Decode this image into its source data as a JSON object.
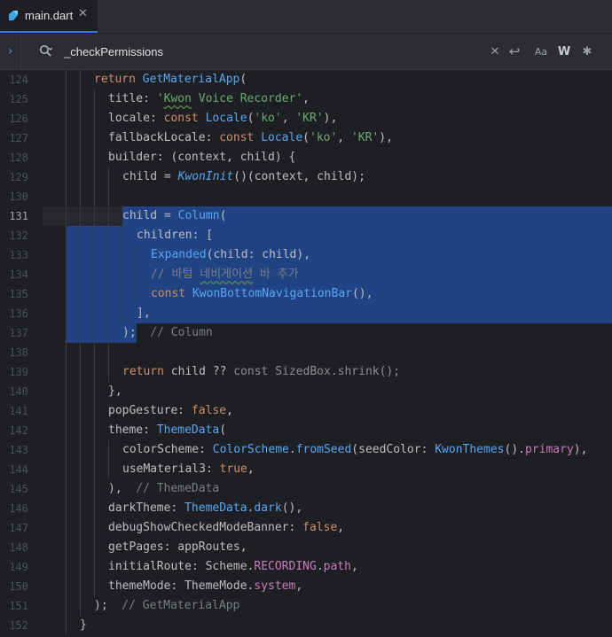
{
  "tab": {
    "label": "main.dart",
    "close_glyph": "✕",
    "icon": "dart-file-icon"
  },
  "search": {
    "query": "_checkPermissions",
    "clear_glyph": "✕",
    "newline_glyph": "↩",
    "match_case_label": "Aa",
    "whole_words_label": "W",
    "regex_glyph": "✱",
    "expand_glyph": "›"
  },
  "editor": {
    "current_line": 131,
    "line_numbers": [
      "124",
      "125",
      "126",
      "127",
      "128",
      "129",
      "130",
      "131",
      "132",
      "133",
      "134",
      "135",
      "136",
      "137",
      "138",
      "139",
      "140",
      "141",
      "142",
      "143",
      "144",
      "145",
      "146",
      "147",
      "148",
      "149",
      "150",
      "151",
      "152"
    ],
    "lines": [
      [
        [
          "kw",
          "return "
        ],
        [
          "fn",
          "GetMaterialApp"
        ],
        [
          "",
          "("
        ]
      ],
      [
        [
          "",
          "title: "
        ],
        [
          "str",
          "'"
        ],
        [
          "str typo",
          "Kwon"
        ],
        [
          "str",
          " Voice Recorder'"
        ],
        [
          "",
          ","
        ]
      ],
      [
        [
          "",
          "locale: "
        ],
        [
          "kw",
          "const "
        ],
        [
          "fn",
          "Locale"
        ],
        [
          "",
          "("
        ],
        [
          "str",
          "'ko'"
        ],
        [
          "",
          ", "
        ],
        [
          "str",
          "'KR'"
        ],
        [
          "",
          "),"
        ]
      ],
      [
        [
          "",
          "fallbackLocale: "
        ],
        [
          "kw",
          "const "
        ],
        [
          "fn",
          "Locale"
        ],
        [
          "",
          "("
        ],
        [
          "str",
          "'ko'"
        ],
        [
          "",
          ", "
        ],
        [
          "str",
          "'KR'"
        ],
        [
          "",
          "),"
        ]
      ],
      [
        [
          "",
          "builder: (context, child) {"
        ]
      ],
      [
        [
          "",
          "child = "
        ],
        [
          "fn ital",
          "KwonInit"
        ],
        [
          "",
          "()(context, child);"
        ]
      ],
      [],
      [
        [
          "",
          "child = "
        ],
        [
          "fn",
          "Column"
        ],
        [
          "",
          "("
        ]
      ],
      [
        [
          "",
          "children: ["
        ]
      ],
      [
        [
          "fn",
          "Expanded"
        ],
        [
          "",
          "(child: child),"
        ]
      ],
      [
        [
          "cm",
          "// 바텀 "
        ],
        [
          "cm typo",
          "네비게이션"
        ],
        [
          "cm",
          " 바 추가"
        ]
      ],
      [
        [
          "kw",
          "const "
        ],
        [
          "fn",
          "KwonBottomNavigationBar"
        ],
        [
          "",
          "(),"
        ]
      ],
      [
        [
          "",
          "],"
        ]
      ],
      [
        [
          "",
          "); "
        ],
        [
          "cm",
          " // Column"
        ]
      ],
      [],
      [
        [
          "kw",
          "return "
        ],
        [
          "",
          "child ?? "
        ],
        [
          "dim",
          "const SizedBox.shrink();"
        ]
      ],
      [
        [
          "",
          "},"
        ]
      ],
      [
        [
          "",
          "popGesture: "
        ],
        [
          "kw",
          "false"
        ],
        [
          "",
          ","
        ]
      ],
      [
        [
          "",
          "theme: "
        ],
        [
          "fn",
          "ThemeData"
        ],
        [
          "",
          "("
        ]
      ],
      [
        [
          "",
          "colorScheme: "
        ],
        [
          "fn",
          "ColorScheme"
        ],
        [
          "",
          "."
        ],
        [
          "fn",
          "fromSeed"
        ],
        [
          "",
          "(seedColor: "
        ],
        [
          "fn",
          "KwonThemes"
        ],
        [
          "",
          "()."
        ],
        [
          "prop",
          "primary"
        ],
        [
          "",
          "),"
        ]
      ],
      [
        [
          "",
          "useMaterial3: "
        ],
        [
          "kw",
          "true"
        ],
        [
          "",
          ","
        ]
      ],
      [
        [
          "",
          "), "
        ],
        [
          "cm",
          " // ThemeData"
        ]
      ],
      [
        [
          "",
          "darkTheme: "
        ],
        [
          "fn",
          "ThemeData"
        ],
        [
          "",
          "."
        ],
        [
          "fn",
          "dark"
        ],
        [
          "",
          "(),"
        ]
      ],
      [
        [
          "",
          "debugShowCheckedModeBanner: "
        ],
        [
          "kw",
          "false"
        ],
        [
          "",
          ","
        ]
      ],
      [
        [
          "",
          "getPages: appRoutes,"
        ]
      ],
      [
        [
          "",
          "initialRoute: Scheme."
        ],
        [
          "prop",
          "RECORDING"
        ],
        [
          "",
          "."
        ],
        [
          "prop",
          "path"
        ],
        [
          "",
          ","
        ]
      ],
      [
        [
          "",
          "themeMode: ThemeMode."
        ],
        [
          "prop",
          "system"
        ],
        [
          "",
          ","
        ]
      ],
      [
        [
          "",
          "); "
        ],
        [
          "cm",
          " // GetMaterialApp"
        ]
      ],
      [
        [
          "",
          "}"
        ]
      ]
    ]
  },
  "colors": {
    "background": "#1e1f22",
    "selection": "#214283",
    "keyword": "#cf8e6d",
    "function": "#56a8f5",
    "string": "#6aab73",
    "comment": "#7a7e85",
    "property": "#c77dbb"
  }
}
